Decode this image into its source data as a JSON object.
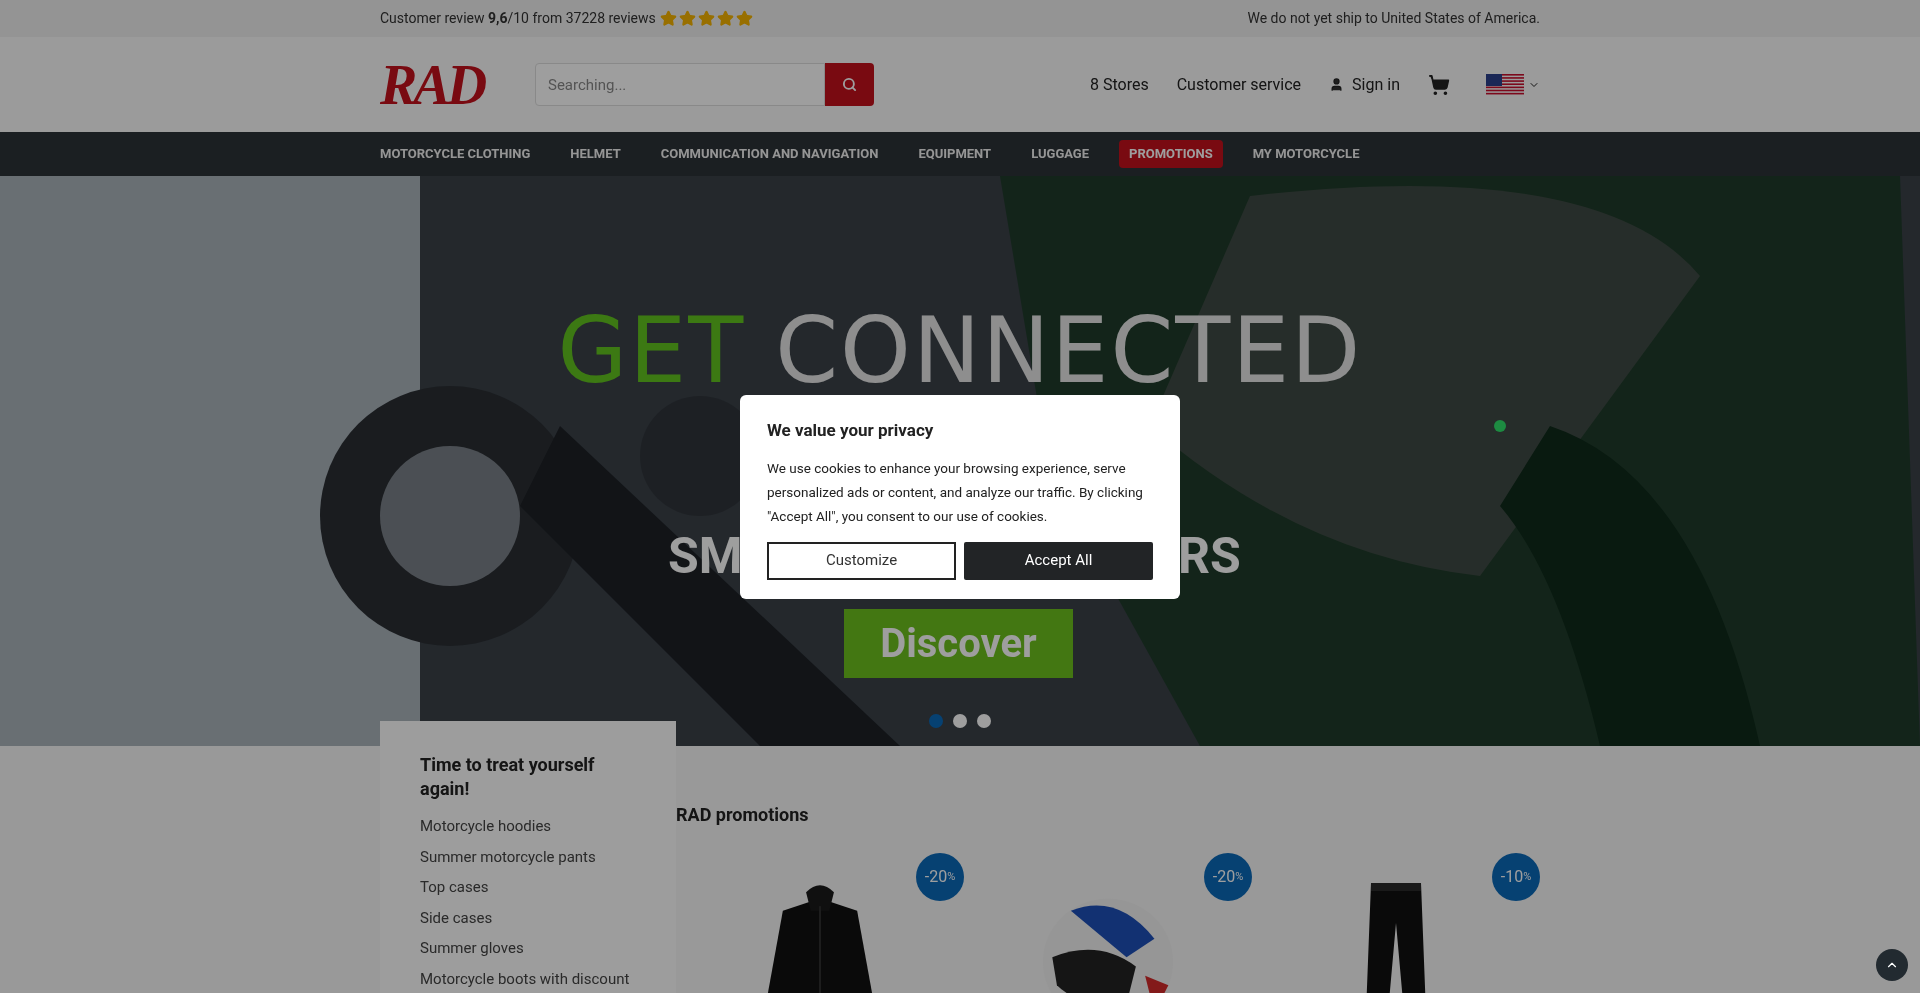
{
  "top_bar": {
    "review": "Customer review **9,6**/10 from 37228 reviews",
    "stars": 5,
    "shipping_note": "We do not yet ship to United States of America."
  },
  "header": {
    "logo": "RAD",
    "search": {
      "placeholder": "Searching..."
    },
    "links": [
      "8 Stores",
      "Customer service"
    ],
    "sign_in": "Sign in"
  },
  "nav": [
    {
      "label": "MOTORCYCLE CLOTHING",
      "selected": false
    },
    {
      "label": "HELMET",
      "selected": false
    },
    {
      "label": "COMMUNICATION AND NAVIGATION",
      "selected": false
    },
    {
      "label": "EQUIPMENT",
      "selected": false
    },
    {
      "label": "LUGGAGE",
      "selected": false
    },
    {
      "label": "PROMOTIONS",
      "selected": true
    },
    {
      "label": "MY MOTORCYCLE",
      "selected": false
    }
  ],
  "hero": {
    "title_accent": "GET",
    "title_rest": "CONNECTED",
    "subtitle_left": "SM",
    "subtitle_right": "RS",
    "button": "Discover",
    "dots": [
      {
        "selected": true
      },
      {
        "selected": false
      },
      {
        "selected": false
      }
    ]
  },
  "sidebar": {
    "title": "Time to treat yourself again!",
    "items": [
      "Motorcycle hoodies",
      "Summer motorcycle pants",
      "Top cases",
      "Side cases",
      "Summer gloves",
      "Motorcycle boots with discount"
    ]
  },
  "promotions": {
    "title": "RAD promotions",
    "products": [
      {
        "kind": "jacket",
        "discount": "-20",
        "unit": "%"
      },
      {
        "kind": "helmet",
        "discount": "-20",
        "unit": "%"
      },
      {
        "kind": "pants",
        "discount": "-10",
        "unit": "%"
      }
    ]
  },
  "cookie_dialog": {
    "title": "We value your privacy",
    "text": "We use cookies to enhance your browsing experience, serve personalized ads or content, and analyze our traffic. By clicking \"Accept All\", you consent to our use of cookies.",
    "buttons": [
      {
        "label": "Customize",
        "kind": "secondary"
      },
      {
        "label": "Accept All",
        "kind": "primary"
      }
    ]
  }
}
